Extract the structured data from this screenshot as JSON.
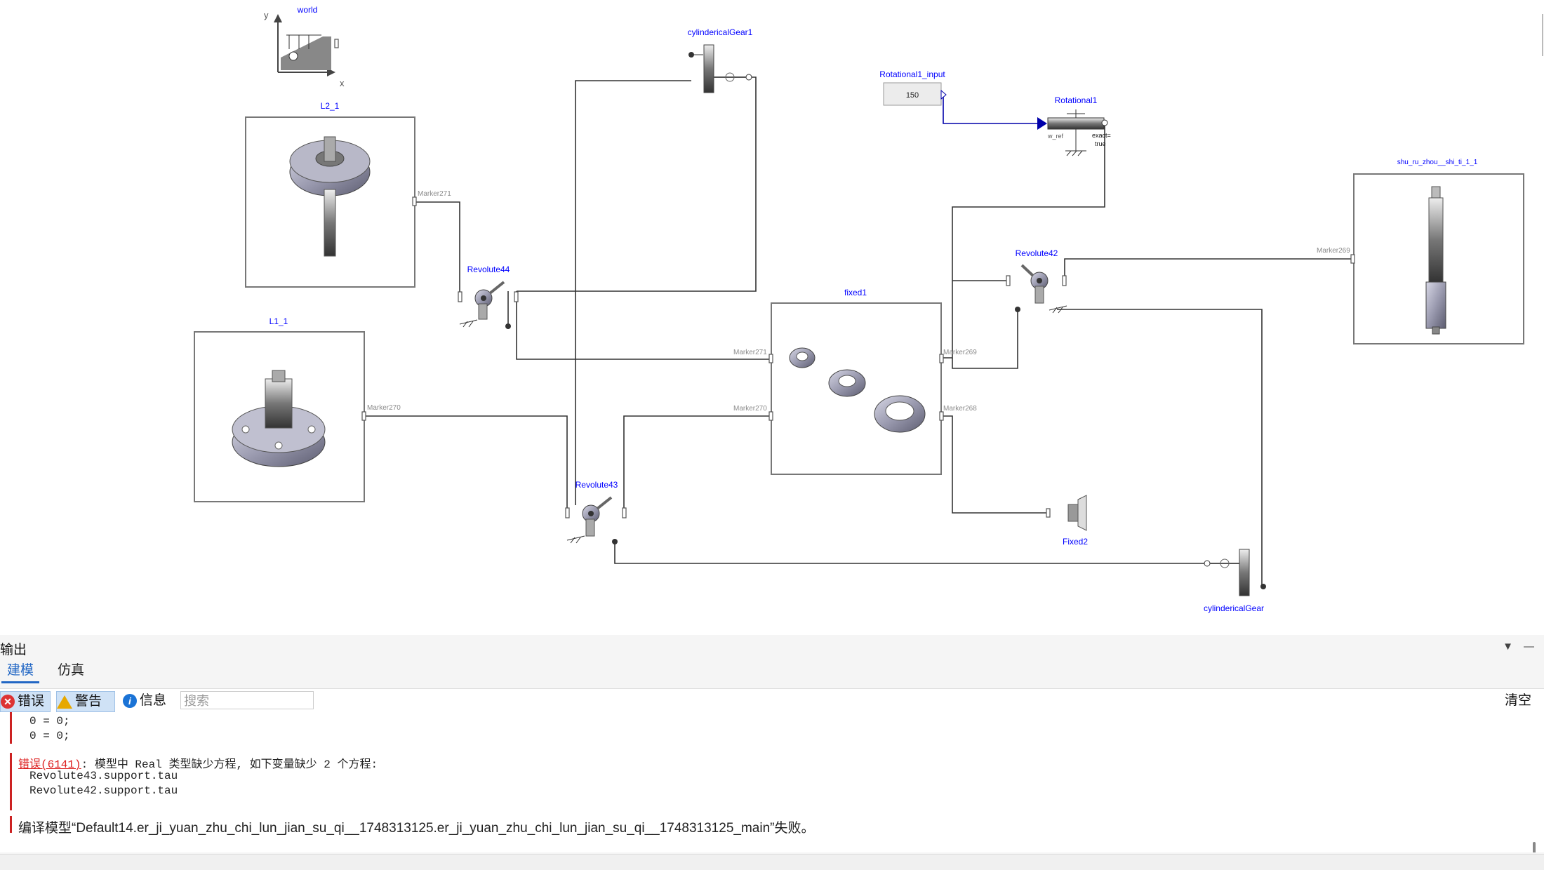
{
  "diagram": {
    "world_label": "world",
    "axis_y": "y",
    "axis_x": "x",
    "L2_label": "L2_1",
    "L1_label": "L1_1",
    "rev44_label": "Revolute44",
    "rev43_label": "Revolute43",
    "rev42_label": "Revolute42",
    "cyl1_label": "cylindericalGear1",
    "cyl_label": "cylindericalGear",
    "rinput_label": "Rotational1_input",
    "rinput_value": "150",
    "rot1_label": "Rotational1",
    "wref": "w_ref",
    "exact_line1": "exact=",
    "exact_line2": "true",
    "fixed1_label": "fixed1",
    "fixed2_label": "Fixed2",
    "shu_label": "shu_ru_zhou__shi_ti_1_1",
    "markers": {
      "m271a": "Marker271",
      "m270a": "Marker270",
      "m271b": "Marker271",
      "m270b": "Marker270",
      "m269a": "Marker269",
      "m268": "Marker268",
      "m269b": "Marker269"
    }
  },
  "panel": {
    "title": "输出",
    "tabs": [
      "建模",
      "仿真"
    ],
    "filters": {
      "error": "错误",
      "warning": "警告",
      "info": "信息"
    },
    "search_placeholder": "搜索",
    "clear": "清空",
    "log": {
      "l1": "0 = 0;",
      "l2": "0 = 0;",
      "err_link": "错误(6141)",
      "err_msg": ": 模型中 Real 类型缺少方程, 如下变量缺少 2 个方程:",
      "l4": "Revolute43.support.tau",
      "l5": "Revolute42.support.tau",
      "compile_fail": "编译模型“Default14.er_ji_yuan_zhu_chi_lun_jian_su_qi__1748313125.er_ji_yuan_zhu_chi_lun_jian_su_qi__1748313125_main”失败。"
    }
  },
  "colors": {
    "label": "#0000ff",
    "accent": "#2166c4",
    "error": "#cc2222"
  }
}
